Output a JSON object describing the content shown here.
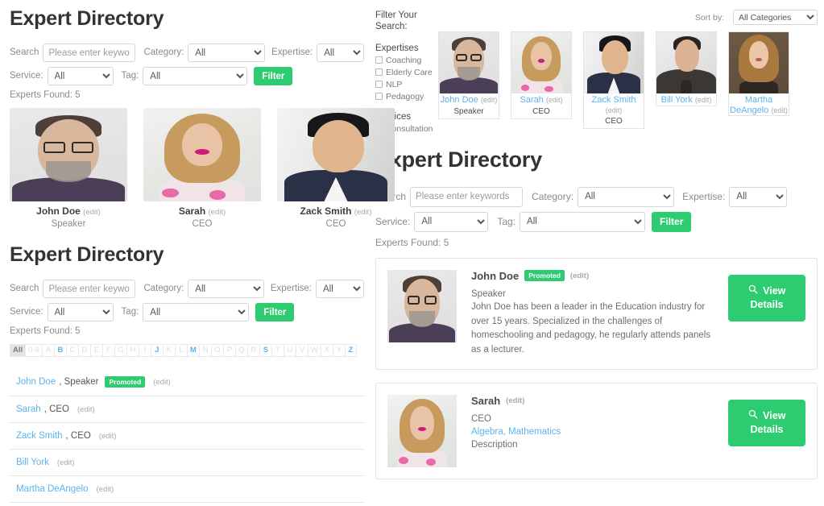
{
  "left_grid_section": {
    "title": "Expert Directory",
    "form": {
      "search_label": "Search",
      "search_placeholder": "Please enter keywords",
      "search_value": "",
      "category_label": "Category:",
      "category_value": "All",
      "expertise_label": "Expertise:",
      "expertise_value": "All",
      "service_label": "Service:",
      "service_value": "All",
      "tag_label": "Tag:",
      "tag_value": "All",
      "filter_button": "Filter"
    },
    "found_text": "Experts Found: 5",
    "edit_label": "(edit)",
    "cards": [
      {
        "name": "John Doe",
        "role": "Speaker",
        "photo": "pJohn"
      },
      {
        "name": "Sarah",
        "role": "CEO",
        "photo": "pSarah"
      },
      {
        "name": "Zack Smith",
        "role": "CEO",
        "photo": "pZack"
      }
    ]
  },
  "left_list_section": {
    "title": "Expert Directory",
    "form": {
      "search_label": "Search",
      "search_placeholder": "Please enter keywords",
      "search_value": "",
      "category_label": "Category:",
      "category_value": "All",
      "expertise_label": "Expertise:",
      "expertise_value": "All",
      "service_label": "Service:",
      "service_value": "All",
      "tag_label": "Tag:",
      "tag_value": "All",
      "filter_button": "Filter"
    },
    "found_text": "Experts Found: 5",
    "edit_label": "(edit)",
    "alphabet": [
      {
        "label": "All",
        "state": "current"
      },
      {
        "label": "0-9",
        "state": "off"
      },
      {
        "label": "A",
        "state": "off"
      },
      {
        "label": "B",
        "state": "on"
      },
      {
        "label": "C",
        "state": "off"
      },
      {
        "label": "D",
        "state": "off"
      },
      {
        "label": "E",
        "state": "off"
      },
      {
        "label": "F",
        "state": "off"
      },
      {
        "label": "G",
        "state": "off"
      },
      {
        "label": "H",
        "state": "off"
      },
      {
        "label": "I",
        "state": "off"
      },
      {
        "label": "J",
        "state": "on"
      },
      {
        "label": "K",
        "state": "off"
      },
      {
        "label": "L",
        "state": "off"
      },
      {
        "label": "M",
        "state": "on"
      },
      {
        "label": "N",
        "state": "off"
      },
      {
        "label": "O",
        "state": "off"
      },
      {
        "label": "P",
        "state": "off"
      },
      {
        "label": "Q",
        "state": "off"
      },
      {
        "label": "R",
        "state": "off"
      },
      {
        "label": "S",
        "state": "on"
      },
      {
        "label": "T",
        "state": "off"
      },
      {
        "label": "U",
        "state": "off"
      },
      {
        "label": "V",
        "state": "off"
      },
      {
        "label": "W",
        "state": "off"
      },
      {
        "label": "X",
        "state": "off"
      },
      {
        "label": "Y",
        "state": "off"
      },
      {
        "label": "Z",
        "state": "on"
      }
    ],
    "rows": [
      {
        "name": "John Doe",
        "sep": ", ",
        "role": "Speaker",
        "promoted": "Promoted"
      },
      {
        "name": "Sarah",
        "sep": ", ",
        "role": "CEO",
        "promoted": ""
      },
      {
        "name": "Zack Smith",
        "sep": ", ",
        "role": "CEO",
        "promoted": ""
      },
      {
        "name": "Bill York",
        "sep": "",
        "role": "",
        "promoted": ""
      },
      {
        "name": "Martha DeAngelo",
        "sep": "",
        "role": "",
        "promoted": ""
      }
    ]
  },
  "right_filter": {
    "title": "Filter Your Search:",
    "expertises_label": "Expertises",
    "expertises": [
      "Coaching",
      "Elderly Care",
      "NLP",
      "Pedagogy"
    ],
    "services_label": "Services",
    "services": [
      "Consultation"
    ]
  },
  "right_carousel": {
    "sort_label": "Sort by:",
    "sort_value": "All Categories",
    "edit_label": "(edit)",
    "cards": [
      {
        "name": "John Doe",
        "role": "Speaker",
        "photo": "pJohn"
      },
      {
        "name": "Sarah",
        "role": "CEO",
        "photo": "pSarah"
      },
      {
        "name": "Zack Smith",
        "role": "CEO",
        "photo": "pZack"
      },
      {
        "name": "Bill York",
        "role": "",
        "photo": "pBill"
      },
      {
        "name": "Martha DeAngelo",
        "role": "",
        "photo": "pMartha"
      }
    ]
  },
  "right_main": {
    "title": "Expert Directory",
    "form": {
      "search_label": "Search",
      "search_placeholder": "Please enter keywords",
      "search_value": "",
      "category_label": "Category:",
      "category_value": "All",
      "expertise_label": "Expertise:",
      "expertise_value": "All",
      "service_label": "Service:",
      "service_value": "All",
      "tag_label": "Tag:",
      "tag_value": "All",
      "filter_button": "Filter"
    },
    "found_text": "Experts Found: 5",
    "edit_label": "(edit)",
    "view_details_label": "View Details",
    "search_icon": "search-icon",
    "details": [
      {
        "name": "John Doe",
        "promoted": "Promoted",
        "role": "Speaker",
        "tags": "",
        "description": "John Doe has been a leader in the Education industry for over 15 years. Specialized in the challenges of homeschooling and pedagogy, he regularly attends panels as a lecturer.",
        "photo": "pJohn"
      },
      {
        "name": "Sarah",
        "promoted": "",
        "role": "CEO",
        "tags": "Algebra, Mathematics",
        "description": "Description",
        "photo": "pSarah"
      }
    ]
  },
  "colors": {
    "accent_green": "#2ecc71",
    "link_blue": "#5bb2ef",
    "heading_dark": "#333333",
    "muted_gray": "#8a8a8a",
    "border_gray": "#e3e3e3"
  }
}
